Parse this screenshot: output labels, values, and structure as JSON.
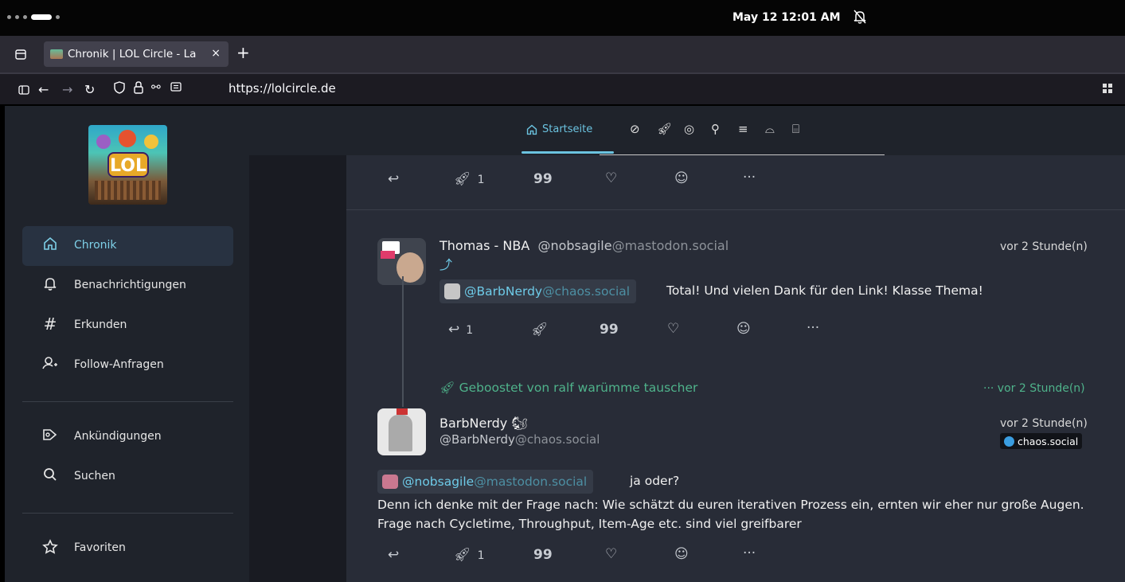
{
  "os": {
    "clock": "May 12  12:01 AM",
    "bell_icon": "bell-off-icon"
  },
  "browser": {
    "tab_title": "Chronik | LOL Circle - La",
    "tab_close": "×",
    "new_tab": "+",
    "url": "https://lolcircle.de"
  },
  "sidebar": {
    "logo_text": "LOL",
    "items": [
      {
        "label": "Chronik",
        "icon": "home-icon"
      },
      {
        "label": "Benachrichtigungen",
        "icon": "bell-icon"
      },
      {
        "label": "Erkunden",
        "icon": "hashtag-icon"
      },
      {
        "label": "Follow-Anfragen",
        "icon": "user-plus-icon"
      },
      {
        "label": "Ankündigungen",
        "icon": "megaphone-icon"
      },
      {
        "label": "Suchen",
        "icon": "search-icon"
      },
      {
        "label": "Favoriten",
        "icon": "star-icon"
      }
    ]
  },
  "topnav": {
    "active_label": "Startseite"
  },
  "posts": {
    "prev_actions": {
      "boost_count": "1"
    },
    "post1": {
      "display_name": "Thomas - NBA",
      "handle": "@nobsagile",
      "domain": "@mastodon.social",
      "time": "vor 2 Stunde(n)",
      "reply_arrow": "⤴",
      "mention_user": "@BarbNerdy",
      "mention_domain": "@chaos.social",
      "text": "Total! Und vielen Dank für den Link! Klasse Thema!",
      "reply_count": "1"
    },
    "boost_banner": {
      "text": "Geboostet von ralf warümme tauscher",
      "time": "··· vor 2 Stunde(n)"
    },
    "post2": {
      "display_name": "BarbNerdy",
      "emoji": "🐿",
      "handle": "@BarbNerdy",
      "domain": "@chaos.social",
      "time": "vor 2 Stunde(n)",
      "instance_badge": "chaos.social",
      "mention_user": "@nobsagile",
      "mention_domain": "@mastodon.social",
      "text_line1": "ja oder?",
      "text_body": "Denn ich denke mit der Frage nach: Wie schätzt du euren iterativen Prozess ein, ernten wir eher nur große Augen. Frage nach Cycletime, Throughput, Item-Age etc. sind viel greifbarer",
      "boost_count": "1"
    }
  },
  "colors": {
    "accent": "#6bc3e0",
    "boost_green": "#4fb38b",
    "feed_bg": "#282c37",
    "sidebar_bg": "#1f232b"
  }
}
